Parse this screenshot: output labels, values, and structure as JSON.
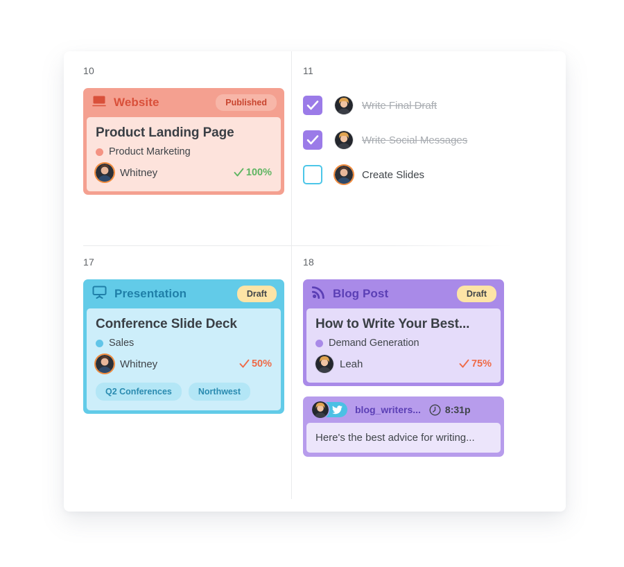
{
  "calendar": {
    "cells": [
      {
        "day": "10",
        "card": {
          "kind": "content-card",
          "type_label": "Website",
          "type_icon": "monitor-icon",
          "badge": "Published",
          "title": "Product Landing Page",
          "category": "Product Marketing",
          "assignee": "Whitney",
          "progress": "100%",
          "progress_state": "complete",
          "colors": {
            "header_bg": "#f4a090",
            "header_text": "#d9503a",
            "body_bg": "#fde3dc",
            "badge_bg": "#f7b6a8",
            "badge_text": "#c8452f",
            "category_dot": "#f49383",
            "progress_text": "#5fb562"
          }
        }
      },
      {
        "day": "11",
        "checklist": [
          {
            "label": "Write Final Draft",
            "checked": true,
            "avatar": "blonde"
          },
          {
            "label": "Write Social Messages",
            "checked": true,
            "avatar": "blonde"
          },
          {
            "label": "Create Slides",
            "checked": false,
            "avatar": "brunette"
          }
        ]
      },
      {
        "day": "17",
        "card": {
          "kind": "content-card",
          "type_label": "Presentation",
          "type_icon": "projector-screen-icon",
          "badge": "Draft",
          "title": "Conference Slide Deck",
          "category": "Sales",
          "assignee": "Whitney",
          "progress": "50%",
          "progress_state": "in-progress",
          "tags": [
            "Q2 Conferences",
            "Northwest"
          ],
          "colors": {
            "header_bg": "#62cbe8",
            "header_text": "#1f7fa8",
            "body_bg": "#cdeefa",
            "badge_bg": "#fde4a6",
            "badge_text": "#3f4449",
            "category_dot": "#62c5e8",
            "progress_text": "#ef6a47",
            "tag_bg": "#b3e6f6",
            "tag_text": "#2a8bb0"
          }
        }
      },
      {
        "day": "18",
        "card": {
          "kind": "content-card",
          "type_label": "Blog Post",
          "type_icon": "rss-icon",
          "badge": "Draft",
          "title": "How to Write Your Best...",
          "category": "Demand Generation",
          "assignee": "Leah",
          "progress": "75%",
          "progress_state": "in-progress",
          "colors": {
            "header_bg": "#a98ae8",
            "header_text": "#5b3fb5",
            "body_bg": "#e5dcfa",
            "badge_bg": "#fde4a6",
            "badge_text": "#3f4449",
            "category_dot": "#a98ae8",
            "progress_text": "#ef6a47"
          }
        },
        "social_card": {
          "kind": "social-post-card",
          "network_icon": "twitter-icon",
          "clock_icon": "clock-icon",
          "handle": "blog_writers...",
          "time": "8:31p",
          "message": "Here's the best advice for writing...",
          "colors": {
            "header_bg": "#b79cec",
            "body_bg": "#ece5fb",
            "network_bg": "#4cc0e4",
            "handle_text": "#5b3fb5"
          }
        }
      }
    ]
  }
}
